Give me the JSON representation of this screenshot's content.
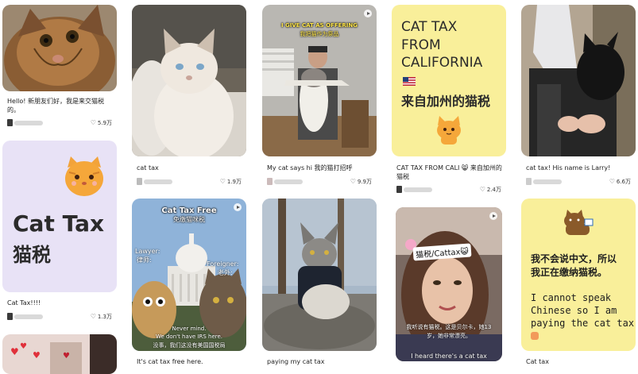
{
  "cards": [
    {
      "id": "c1",
      "caption": "Hello! 新朋友们好，我是来交猫税的。",
      "likes": "5.9万"
    },
    {
      "id": "c2",
      "caption": "Cat Tax!!!!",
      "likes": "1.3万",
      "image_text": {
        "title_en": "Cat Tax",
        "title_zh": "猫税"
      }
    },
    {
      "id": "c3",
      "caption": "cat tax",
      "likes": "1.9万"
    },
    {
      "id": "c4",
      "caption": "It's cat tax free here.",
      "image_text": {
        "top_en": "Cat Tax Free",
        "top_zh": "免缴猫咪税",
        "left_en": "Lawyer:",
        "left_zh": "律师:",
        "right_en": "Foreigner:",
        "right_zh": "老外:",
        "bottom_en": "Never mind.",
        "bottom_en2": "We don't have IRS here.",
        "bottom_zh": "没事，我们这没有美国国税局"
      }
    },
    {
      "id": "c5",
      "caption": "My cat says hi 我的猫打招呼",
      "likes": "9.9万",
      "image_text": {
        "top_en": "I GIVE CAT AS OFFERING",
        "top_zh": "我把猫作为祭品"
      }
    },
    {
      "id": "c6",
      "caption": "paying my cat tax"
    },
    {
      "id": "c7",
      "caption": "CAT TAX FROM CALI 😸 来自加州的猫税",
      "likes": "2.4万",
      "image_text": {
        "line1": "CAT TAX",
        "line2": "FROM",
        "line3": "CALIFORNIA",
        "zh": "来自加州的猫税"
      }
    },
    {
      "id": "c8",
      "caption": "",
      "image_text": {
        "label": "猫税/Cattax😺",
        "sub1": "我听说有猫税。这是贝尔卡，她13",
        "sub2": "岁，她非常漂亮。",
        "bottom": "I heard there's a cat tax"
      }
    },
    {
      "id": "c9",
      "caption": "cat tax! His name is Larry!",
      "likes": "6.6万"
    },
    {
      "id": "c10",
      "caption": "Cat tax",
      "image_text": {
        "zh1": "我不会说中文，所以",
        "zh2": "我正在缴纳猫税。",
        "en1": "I cannot speak",
        "en2": "Chinese so I am",
        "en3": "paying the cat tax"
      }
    }
  ],
  "colors": {
    "accent": "#e8e0f7",
    "yellow": "#f9ef9a",
    "text": "#222222",
    "orange": "#f5a73a"
  },
  "icons": {
    "heart": "heart-icon",
    "play": "play-icon",
    "avatar": "avatar"
  }
}
